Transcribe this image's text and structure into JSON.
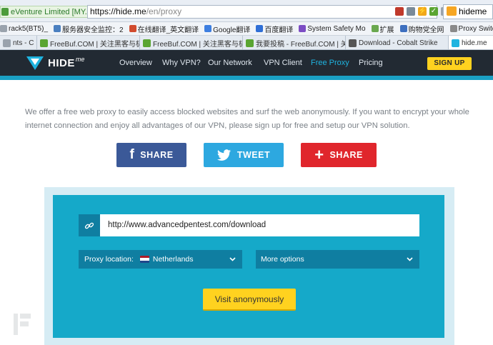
{
  "browser": {
    "site_identity": "eVenture Limited [MY...",
    "url_host": "https://hide.me",
    "url_path": "/en/proxy",
    "search_text": "hideme"
  },
  "bookmarks": [
    {
      "label": "rack5(BT5)_",
      "color": "#9aa3ad"
    },
    {
      "label": "服务器安全监控：2",
      "color": "#4a7fc0"
    },
    {
      "label": "在线翻译_英文翻译",
      "color": "#d14b2e"
    },
    {
      "label": "Google翻译",
      "color": "#3d7ee0"
    },
    {
      "label": "百度翻译",
      "color": "#2f6fd6"
    },
    {
      "label": "System Safety Mo",
      "color": "#7c4dc4"
    },
    {
      "label": "扩展",
      "color": "#6aa84f"
    },
    {
      "label": "购物党全网",
      "color": "#3d6fbf"
    },
    {
      "label": "Proxy Switc",
      "color": "#8a8a8a"
    }
  ],
  "tabs": [
    {
      "label": "nts - C",
      "color": "#9aa3ad",
      "active": false
    },
    {
      "label": "FreeBuf.COM | 关注黑客与极",
      "color": "#5aa532",
      "active": false
    },
    {
      "label": "FreeBuf.COM | 关注黑客与极",
      "color": "#5aa532",
      "active": false
    },
    {
      "label": "我要投稿 - FreeBuf.COM | 关",
      "color": "#5aa532",
      "active": false
    },
    {
      "label": "Download - Cobalt Strike",
      "color": "#555555",
      "active": false
    },
    {
      "label": "hide.me",
      "color": "#1fb4e0",
      "active": true
    }
  ],
  "site": {
    "logo": "HIDE",
    "logo_sup": "me",
    "nav": [
      "Overview",
      "Why VPN?",
      "Our Network",
      "VPN Client",
      "Free Proxy",
      "Pricing"
    ],
    "active_nav": "Free Proxy",
    "signup": "SIGN UP"
  },
  "intro": "We offer a free web proxy to easily access blocked websites and surf the web anonymously. If you want to encrypt your whole internet connection and enjoy all advantages of our VPN, please sign up for free and setup our VPN solution.",
  "share": {
    "facebook": "SHARE",
    "twitter": "TWEET",
    "plus": "SHARE"
  },
  "proxy": {
    "url_value": "http://www.advancedpentest.com/download",
    "location_label": "Proxy location:",
    "location_value": "Netherlands",
    "options_label": "More options",
    "visit_button": "Visit anonymously"
  },
  "watermark": "FREEBUF",
  "colors": {
    "header_bg": "#222a33",
    "accent_teal": "#15a9c9",
    "accent_yellow": "#ffd21f",
    "facebook": "#3b5998",
    "twitter": "#2da8e0",
    "plus": "#e0262c"
  }
}
